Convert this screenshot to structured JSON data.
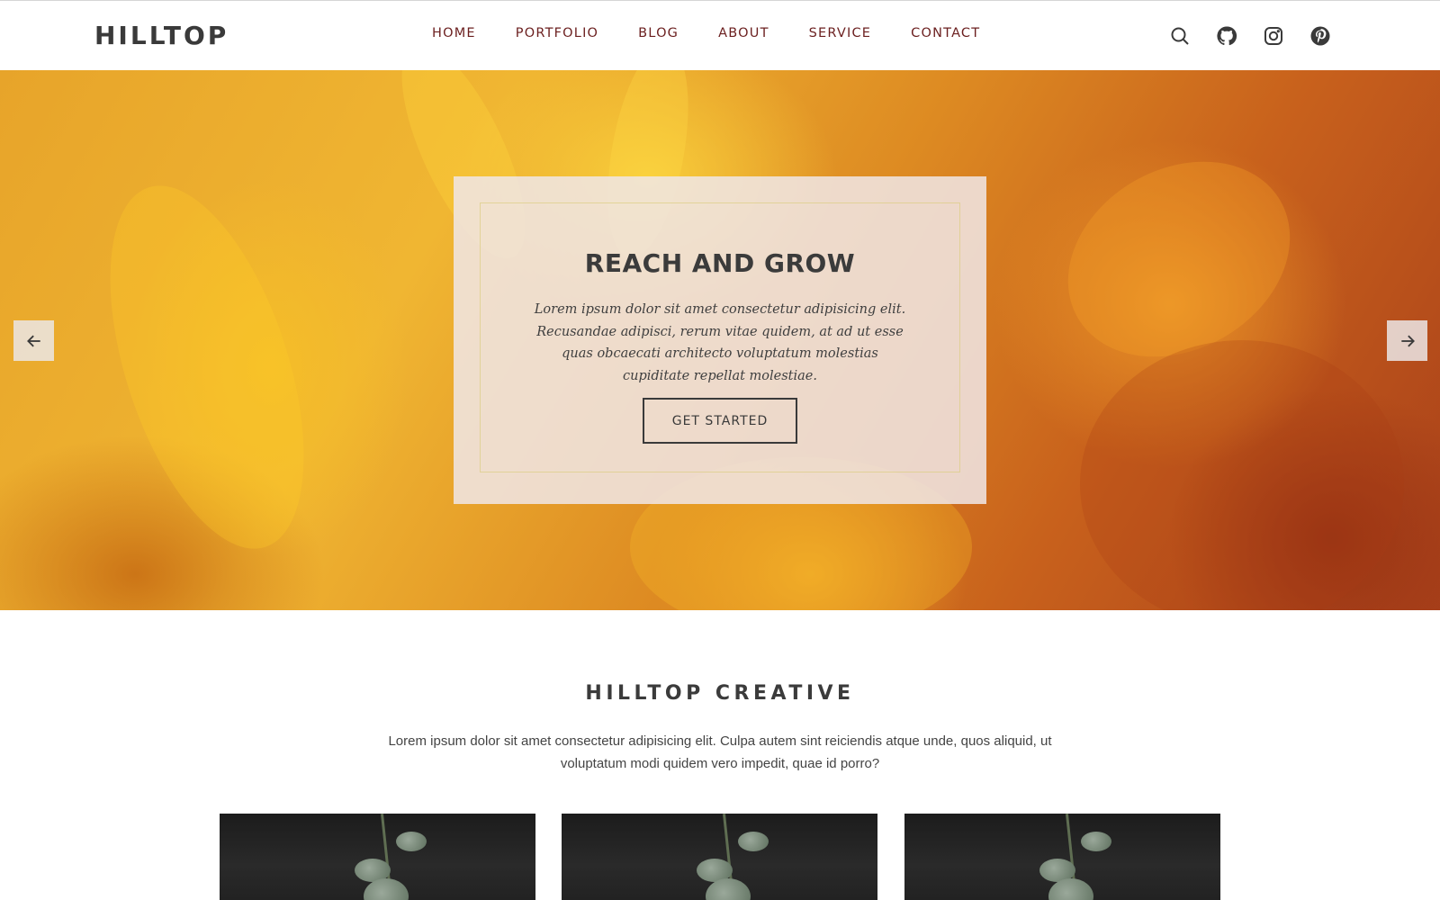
{
  "header": {
    "logo": "HILLTOP",
    "nav": [
      "HOME",
      "PORTFOLIO",
      "BLOG",
      "ABOUT",
      "SERVICE",
      "CONTACT"
    ],
    "icons": [
      "search-icon",
      "github-icon",
      "instagram-icon",
      "pinterest-icon"
    ]
  },
  "hero": {
    "title": "REACH AND GROW",
    "text": "Lorem ipsum dolor sit amet consectetur adipisicing elit. Recusandae adipisci, rerum vitae quidem, at ad ut esse quas obcaecati architecto voluptatum molestias cupiditate repellat molestiae.",
    "button": "GET STARTED",
    "prev_icon": "arrow-left-icon",
    "next_icon": "arrow-right-icon"
  },
  "section": {
    "title": "HILLTOP CREATIVE",
    "text": "Lorem ipsum dolor sit amet consectetur adipisicing elit. Culpa autem sint reiciendis atque unde, quos aliquid, ut voluptatum modi quidem vero impedit, quae id porro?"
  },
  "colors": {
    "nav_text": "#6b1f1f",
    "heading": "#3b3b3b",
    "hero_overlay": "#f0e6e6"
  }
}
